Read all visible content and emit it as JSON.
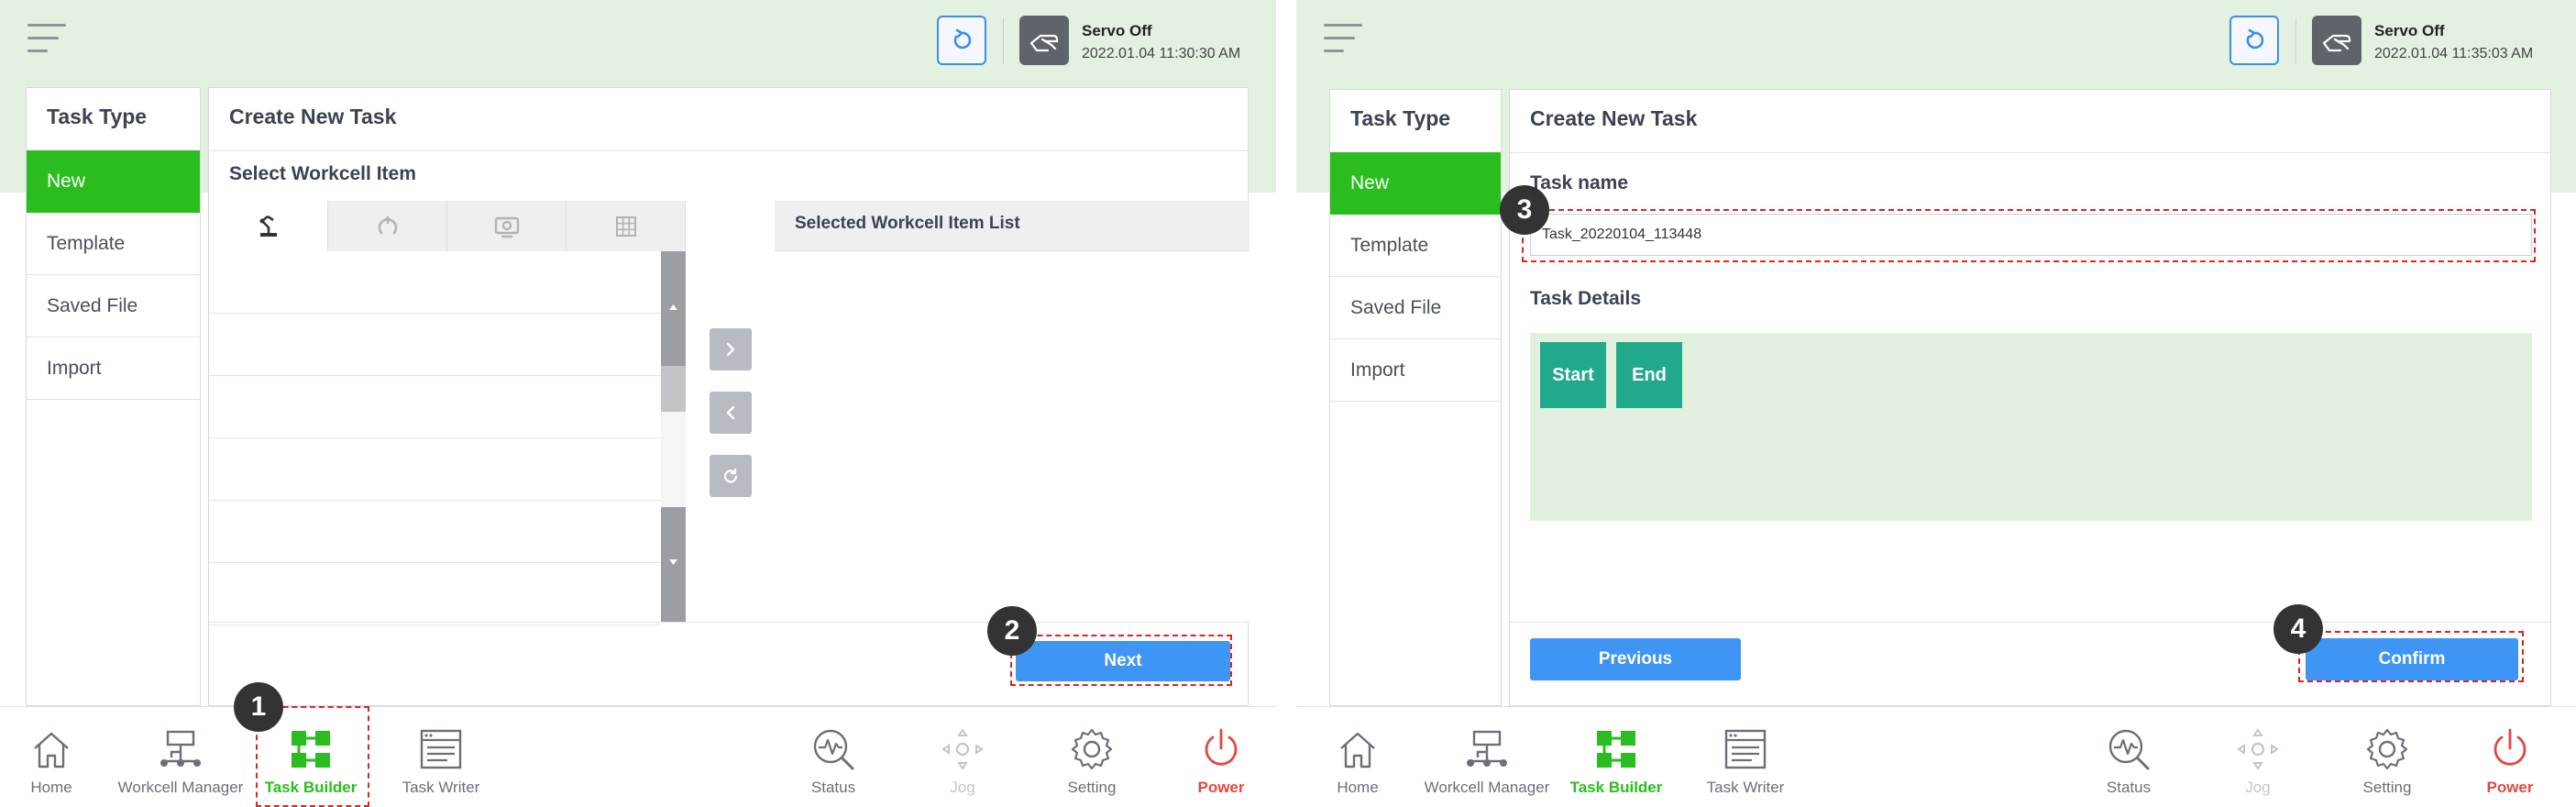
{
  "left": {
    "servo": {
      "status": "Servo Off",
      "datetime": "2022.01.04 11:30:30 AM"
    },
    "task_type": {
      "title": "Task Type",
      "items": [
        {
          "label": "New",
          "active": true
        },
        {
          "label": "Template"
        },
        {
          "label": "Saved File"
        },
        {
          "label": "Import"
        }
      ]
    },
    "main": {
      "title": "Create New Task",
      "section": "Select Workcell Item",
      "tab_icons": [
        "robot-arm-icon",
        "gripper-icon",
        "camera-icon",
        "grid-icon"
      ],
      "selected_list_header": "Selected Workcell Item List",
      "next_button": "Next"
    },
    "badges": [
      "1",
      "2"
    ]
  },
  "right": {
    "servo": {
      "status": "Servo Off",
      "datetime": "2022.01.04 11:35:03 AM"
    },
    "task_type": {
      "title": "Task Type",
      "items": [
        {
          "label": "New",
          "active": true
        },
        {
          "label": "Template"
        },
        {
          "label": "Saved File"
        },
        {
          "label": "Import"
        }
      ]
    },
    "main": {
      "title": "Create New Task",
      "task_name_label": "Task name",
      "task_name_value": "Task_20220104_113448",
      "task_details_label": "Task Details",
      "blocks": [
        "Start",
        "End"
      ],
      "previous_button": "Previous",
      "confirm_button": "Confirm"
    },
    "badges": [
      "3",
      "4"
    ]
  },
  "nav": {
    "items": [
      {
        "label": "Home",
        "icon": "home-icon"
      },
      {
        "label": "Workcell Manager",
        "icon": "workcell-manager-icon"
      },
      {
        "label": "Task Builder",
        "icon": "task-builder-icon",
        "active": true
      },
      {
        "label": "Task Writer",
        "icon": "task-writer-icon"
      },
      {
        "label": "Status",
        "icon": "status-icon"
      },
      {
        "label": "Jog",
        "icon": "jog-icon",
        "disabled": true
      },
      {
        "label": "Setting",
        "icon": "setting-icon"
      },
      {
        "label": "Power",
        "icon": "power-icon"
      }
    ]
  },
  "colors": {
    "accent_green": "#2bbd1f",
    "primary_blue": "#3f95f3",
    "highlight_red": "#e2221f",
    "header_green": "#e3f1e1",
    "block_teal": "#20a98a"
  }
}
